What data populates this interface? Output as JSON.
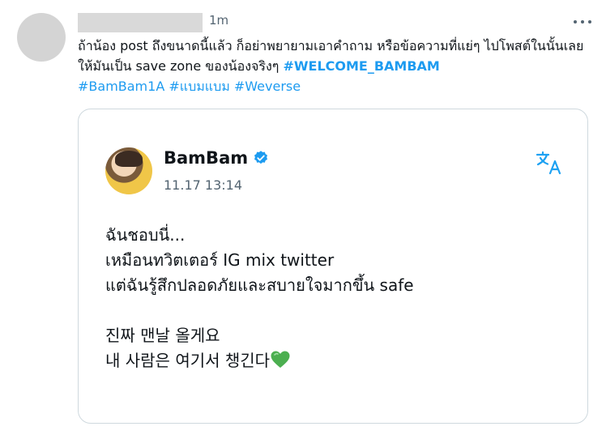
{
  "tweet": {
    "timestamp": "1m",
    "text_plain": "ถ้าน้อง post ถึงขนาดนี้แล้ว ก็อย่าพยายามเอาคำถาม หรือข้อความที่แย่ๆ ไปโพสต์ในนั้นเลย ให้มันเป็น save zone ของน้องจริงๆ ",
    "hashtag_welcome": "#WELCOME_BAMBAM",
    "hashtag_1": "#BamBam1A",
    "hashtag_2": "#แบมแบม",
    "hashtag_3": "#Weverse"
  },
  "card": {
    "author_name": "BamBam",
    "date": "11.17 13:14",
    "body_line_1": "ฉันชอบนี่...",
    "body_line_2": "เหมือนทวิตเตอร์ IG mix twitter",
    "body_line_3": "แต่ฉันรู้สึกปลอดภัยและสบายใจมากขึ้น safe",
    "body_line_4": "진짜 맨날 올게요",
    "body_line_5": "내 사람은 여기서 챙긴다"
  },
  "icons": {
    "more": "more-icon",
    "verified": "verified-icon",
    "translate": "translate-icon",
    "heart": "green-heart-icon"
  },
  "colors": {
    "link": "#1d9bf0",
    "muted": "#536471",
    "verified": "#1d9bf0",
    "translate": "#1da1f2",
    "heart": "#4caf50"
  }
}
